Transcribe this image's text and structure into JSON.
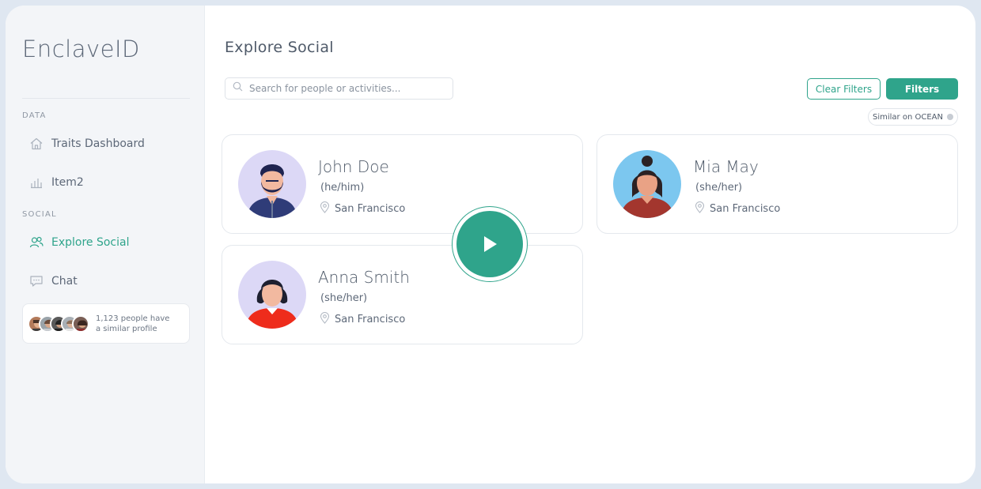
{
  "app": {
    "brand": "EnclaveID"
  },
  "sidebar": {
    "sections": [
      {
        "label": "DATA"
      },
      {
        "label": "SOCIAL"
      }
    ],
    "items": [
      {
        "label": "Traits Dashboard",
        "icon": "home-icon"
      },
      {
        "label": "Item2",
        "icon": "bar-chart-icon"
      },
      {
        "label": "Explore Social",
        "icon": "users-icon",
        "active": true
      },
      {
        "label": "Chat",
        "icon": "chat-bubble-icon"
      }
    ],
    "similar": {
      "text": "1,123 people have a similar profile"
    }
  },
  "main": {
    "title": "Explore Social",
    "search": {
      "placeholder": "Search for people or activities..."
    },
    "clear_filters_label": "Clear Filters",
    "filters_label": "Filters",
    "active_filter_chip": "Similar on OCEAN"
  },
  "people": [
    {
      "name": "John Doe",
      "pronouns": "(he/him)",
      "location": "San Francisco"
    },
    {
      "name": "Mia May",
      "pronouns": "(she/her)",
      "location": "San Francisco"
    },
    {
      "name": "Anna Smith",
      "pronouns": "(she/her)",
      "location": "San Francisco"
    }
  ],
  "colors": {
    "accent": "#2fa48b",
    "sidebar_bg": "#f3f5f8",
    "text": "#4f5a69"
  }
}
